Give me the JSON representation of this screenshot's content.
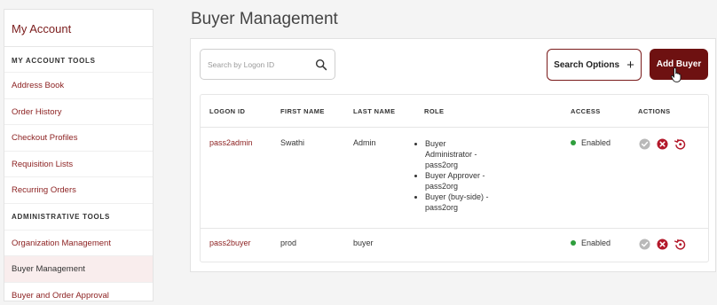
{
  "sidebar": {
    "title": "My Account",
    "sections": [
      {
        "heading": "MY ACCOUNT TOOLS",
        "items": [
          {
            "label": "Address Book"
          },
          {
            "label": "Order History"
          },
          {
            "label": "Checkout Profiles"
          },
          {
            "label": "Requisition Lists"
          },
          {
            "label": "Recurring Orders"
          }
        ]
      },
      {
        "heading": "ADMINISTRATIVE TOOLS",
        "items": [
          {
            "label": "Organization Management"
          },
          {
            "label": "Buyer Management",
            "active": true
          },
          {
            "label": "Buyer and Order Approval"
          }
        ]
      }
    ]
  },
  "page": {
    "title": "Buyer Management"
  },
  "toolbar": {
    "search_placeholder": "Search by Logon ID",
    "search_icon": "search-icon",
    "search_options_label": "Search Options",
    "search_options_icon": "+",
    "add_buyer_label": "Add Buyer"
  },
  "table": {
    "columns": [
      "LOGON ID",
      "FIRST NAME",
      "LAST NAME",
      "ROLE",
      "ACCESS",
      "ACTIONS"
    ],
    "rows": [
      {
        "logon_id": "pass2admin",
        "first_name": "Swathi",
        "last_name": "Admin",
        "roles": [
          "Buyer Administrator - pass2org",
          "Buyer Approver - pass2org",
          "Buyer (buy-side) - pass2org"
        ],
        "access": "Enabled"
      },
      {
        "logon_id": "pass2buyer",
        "first_name": "prod",
        "last_name": "buyer",
        "roles": [],
        "access": "Enabled"
      }
    ],
    "action_icons": [
      "check-icon",
      "disable-icon",
      "reset-icon"
    ]
  },
  "colors": {
    "brand": "#6e1111",
    "link": "#8b1f1f",
    "enabled_dot": "#2e9e3c",
    "check_icon": "#b9b9b9",
    "disable_icon": "#b3182a",
    "reset_icon": "#b3182a"
  }
}
